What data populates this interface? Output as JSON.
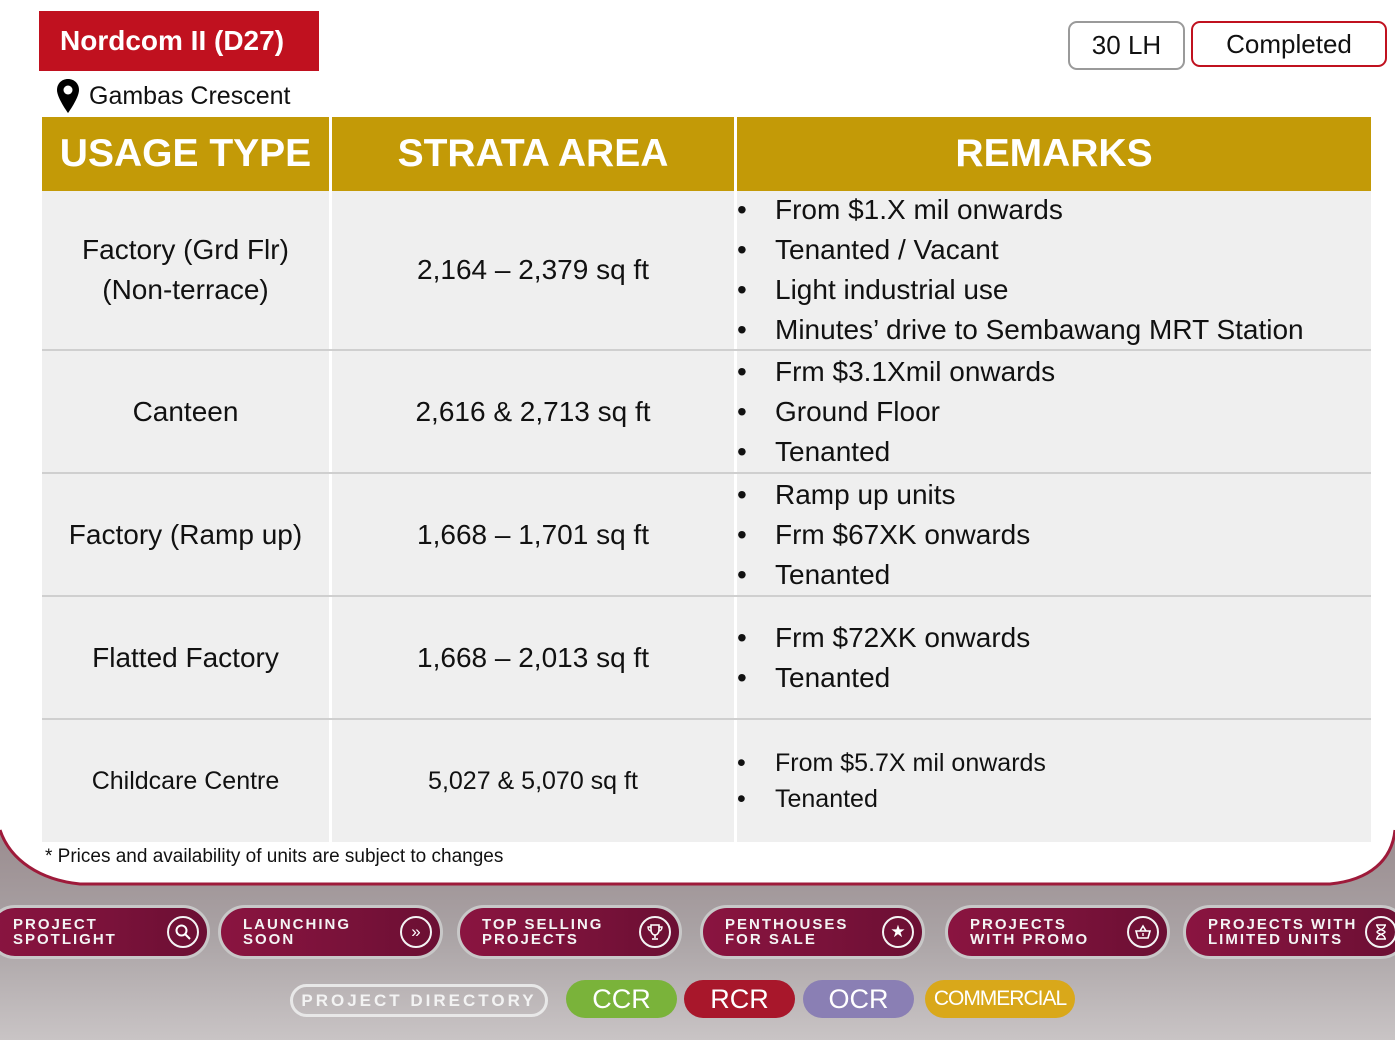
{
  "header": {
    "title": "Nordcom II (D27)",
    "location": "Gambas Crescent",
    "tenure": "30 LH",
    "status": "Completed"
  },
  "table": {
    "headers": [
      "USAGE TYPE",
      "STRATA AREA",
      "REMARKS"
    ],
    "rows": [
      {
        "usage": [
          "Factory (Grd Flr)",
          "(Non-terrace)"
        ],
        "area": "2,164 – 2,379 sq ft",
        "remarks": [
          "From $1.X mil onwards",
          "Tenanted / Vacant",
          "Light industrial use",
          "Minutes’ drive to Sembawang MRT Station"
        ]
      },
      {
        "usage": [
          "Canteen"
        ],
        "area": "2,616 & 2,713 sq ft",
        "remarks": [
          "Frm $3.1Xmil onwards",
          "Ground Floor",
          "Tenanted"
        ]
      },
      {
        "usage": [
          "Factory (Ramp up)"
        ],
        "area": "1,668 – 1,701 sq ft",
        "remarks": [
          "Ramp up units",
          "Frm $67XK onwards",
          "Tenanted"
        ]
      },
      {
        "usage": [
          "Flatted Factory"
        ],
        "area": "1,668 – 2,013 sq ft",
        "remarks": [
          "Frm $72XK onwards",
          "Tenanted"
        ]
      },
      {
        "usage": [
          "Childcare Centre"
        ],
        "area": "5,027 & 5,070 sq ft",
        "remarks": [
          "From $5.7X mil onwards",
          "Tenanted"
        ]
      }
    ]
  },
  "footnote": "* Prices and availability of units are subject to changes",
  "nav": {
    "buttons": [
      {
        "line1": "PROJECT",
        "line2": "SPOTLIGHT",
        "icon": "search-icon"
      },
      {
        "line1": "LAUNCHING",
        "line2": "SOON",
        "icon": "double-chevron-right-icon"
      },
      {
        "line1": "TOP SELLING",
        "line2": "PROJECTS",
        "icon": "trophy-icon"
      },
      {
        "line1": "PENTHOUSES",
        "line2": "FOR SALE",
        "icon": "star-icon"
      },
      {
        "line1": "PROJECTS",
        "line2": "WITH PROMO",
        "icon": "shopping-basket-icon"
      },
      {
        "line1": "PROJECTS WITH",
        "line2": "LIMITED UNITS",
        "icon": "hourglass-icon"
      }
    ],
    "directory": "PROJECT DIRECTORY",
    "regions": [
      "CCR",
      "RCR",
      "OCR",
      "COMMERCIAL"
    ]
  },
  "colors": {
    "title_bg": "#c0111f",
    "table_header": "#c39a07",
    "row_bg": "#efefef",
    "nav_bg": "#7a123a",
    "ccr": "#7ab33a",
    "rcr": "#a8172b",
    "ocr": "#8a7fb4",
    "commercial": "#d9a81a"
  }
}
